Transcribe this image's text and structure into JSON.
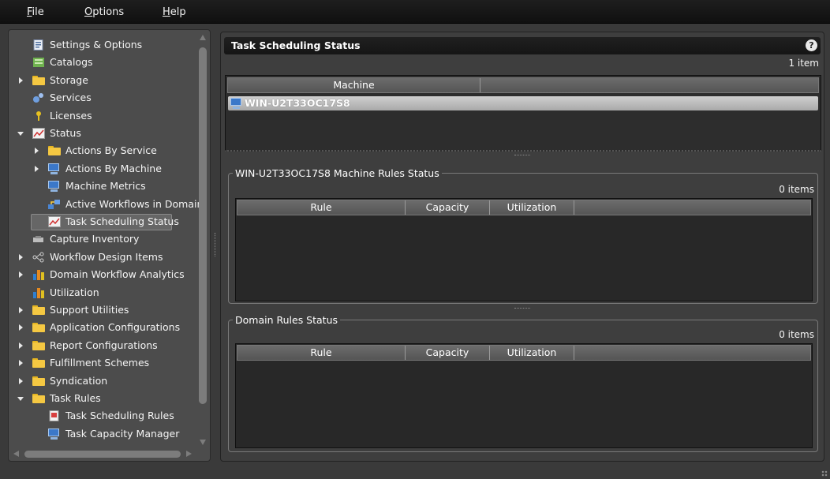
{
  "menu": [
    {
      "label": "File",
      "accel": "F",
      "rest": "ile"
    },
    {
      "label": "Options",
      "accel": "O",
      "rest": "ptions"
    },
    {
      "label": "Help",
      "accel": "H",
      "rest": "elp"
    }
  ],
  "nav": {
    "items": [
      {
        "label": "Settings & Options",
        "icon": "settings-icon",
        "expander": "none"
      },
      {
        "label": "Catalogs",
        "icon": "catalogs-icon",
        "expander": "none"
      },
      {
        "label": "Storage",
        "icon": "folder-icon",
        "expander": "collapsed"
      },
      {
        "label": "Services",
        "icon": "services-icon",
        "expander": "none"
      },
      {
        "label": "Licenses",
        "icon": "key-icon",
        "expander": "none"
      },
      {
        "label": "Status",
        "icon": "status-chart-icon",
        "expander": "expanded"
      },
      {
        "label": "Actions By Service",
        "icon": "folder-icon",
        "expander": "collapsed"
      },
      {
        "label": "Actions By Machine",
        "icon": "machine-icon",
        "expander": "collapsed"
      },
      {
        "label": "Machine Metrics",
        "icon": "machine-icon",
        "expander": "none"
      },
      {
        "label": "Active Workflows in Domain",
        "icon": "workflow-icon",
        "expander": "none"
      },
      {
        "label": "Task Scheduling Status",
        "icon": "status-chart-icon",
        "expander": "none",
        "selected": true
      },
      {
        "label": "Capture Inventory",
        "icon": "capture-icon",
        "expander": "none"
      },
      {
        "label": "Workflow Design Items",
        "icon": "workflow-design-icon",
        "expander": "collapsed"
      },
      {
        "label": "Domain Workflow Analytics",
        "icon": "analytics-icon",
        "expander": "collapsed"
      },
      {
        "label": "Utilization",
        "icon": "analytics-icon",
        "expander": "none"
      },
      {
        "label": "Support Utilities",
        "icon": "folder-icon",
        "expander": "collapsed"
      },
      {
        "label": "Application Configurations",
        "icon": "folder-icon",
        "expander": "collapsed"
      },
      {
        "label": "Report Configurations",
        "icon": "folder-icon",
        "expander": "collapsed"
      },
      {
        "label": "Fulfillment Schemes",
        "icon": "folder-icon",
        "expander": "collapsed"
      },
      {
        "label": "Syndication",
        "icon": "folder-icon",
        "expander": "collapsed"
      },
      {
        "label": "Task Rules",
        "icon": "folder-icon",
        "expander": "expanded"
      },
      {
        "label": "Task Scheduling Rules",
        "icon": "scheduling-rules-icon",
        "expander": "none"
      },
      {
        "label": "Task Capacity Manager",
        "icon": "machine-icon",
        "expander": "none"
      }
    ]
  },
  "content": {
    "title": "Task Scheduling Status",
    "help": "?",
    "machine_count": "1 item",
    "machine_grid": {
      "columns": [
        "Machine",
        ""
      ],
      "rows": [
        "WIN-U2T33OC17S8"
      ]
    },
    "machine_rules": {
      "title": "WIN-U2T33OC17S8 Machine Rules Status",
      "count": "0 items",
      "columns": [
        "Rule",
        "Capacity",
        "Utilization",
        ""
      ]
    },
    "domain_rules": {
      "title": "Domain Rules Status",
      "count": "0 items",
      "columns": [
        "Rule",
        "Capacity",
        "Utilization",
        ""
      ]
    }
  },
  "colors": {
    "background": "#3a3a3a",
    "panel": "#4c4c4c",
    "selected_row": "#bdbdbd",
    "folder": "#f5c842",
    "machine_blue": "#3b78c9"
  }
}
